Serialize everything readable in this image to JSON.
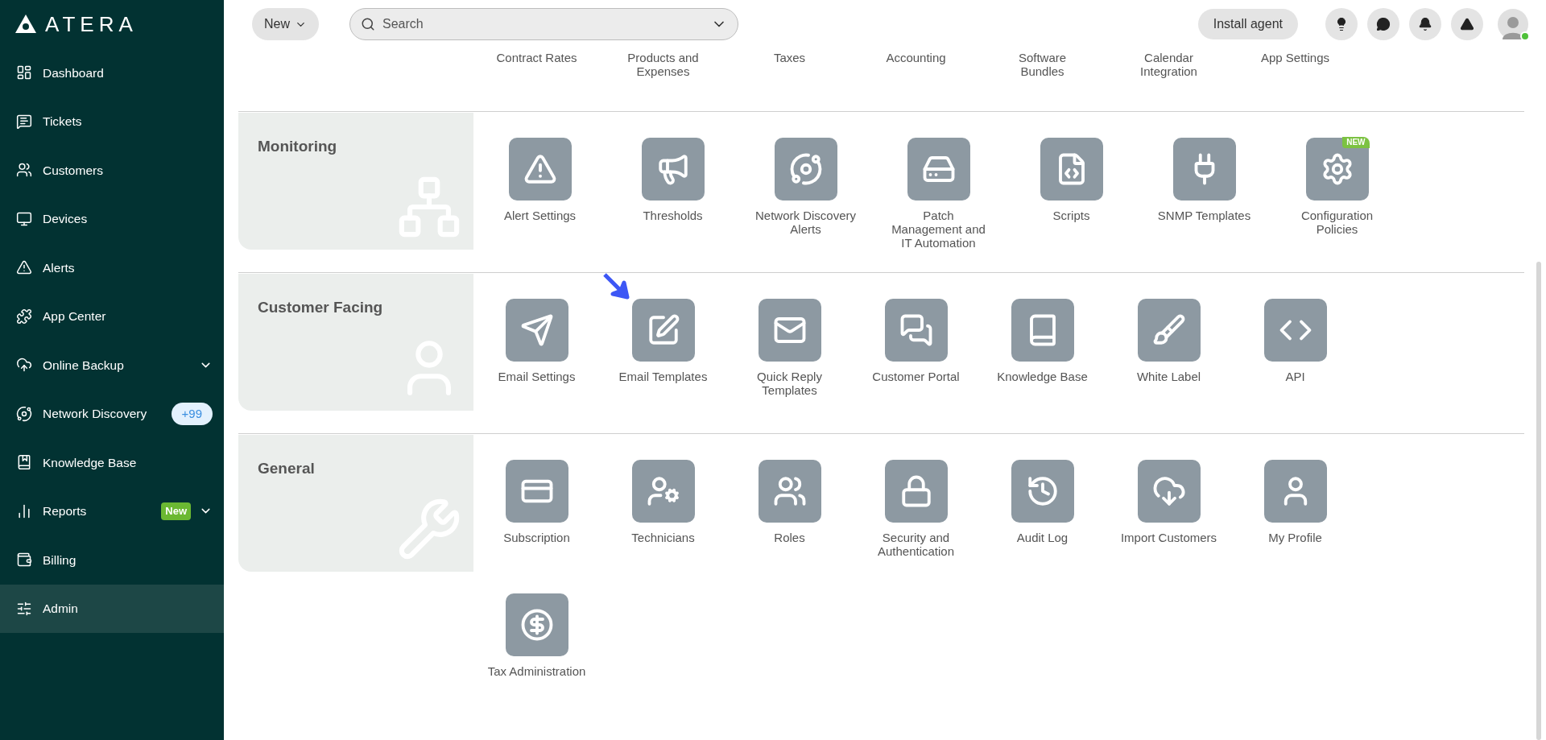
{
  "brand": {
    "name": "ATERA"
  },
  "sidebar": {
    "items": [
      {
        "label": "Dashboard",
        "selected": false,
        "expandable": false
      },
      {
        "label": "Tickets",
        "selected": false,
        "expandable": false
      },
      {
        "label": "Customers",
        "selected": false,
        "expandable": false
      },
      {
        "label": "Devices",
        "selected": false,
        "expandable": false
      },
      {
        "label": "Alerts",
        "selected": false,
        "expandable": false
      },
      {
        "label": "App Center",
        "selected": false,
        "expandable": false
      },
      {
        "label": "Online Backup",
        "selected": false,
        "expandable": true
      },
      {
        "label": "Network Discovery",
        "selected": false,
        "expandable": false,
        "badge": {
          "kind": "count",
          "text": "+99"
        }
      },
      {
        "label": "Knowledge Base",
        "selected": false,
        "expandable": false
      },
      {
        "label": "Reports",
        "selected": false,
        "expandable": true,
        "badge": {
          "kind": "new",
          "text": "New"
        }
      },
      {
        "label": "Billing",
        "selected": false,
        "expandable": false
      },
      {
        "label": "Admin",
        "selected": true,
        "expandable": false
      }
    ]
  },
  "topbar": {
    "new_button": "New",
    "search": {
      "placeholder": "Search"
    },
    "install_button": "Install agent",
    "user_online": true
  },
  "previous_section_items": [
    "Contract Rates",
    "Products and Expenses",
    "Taxes",
    "Accounting",
    "Software Bundles",
    "Calendar Integration",
    "App Settings"
  ],
  "sections": [
    {
      "title": "Monitoring",
      "items": [
        {
          "label": "Alert Settings"
        },
        {
          "label": "Thresholds"
        },
        {
          "label": "Network Discovery Alerts"
        },
        {
          "label": "Patch Management and IT Automation"
        },
        {
          "label": "Scripts"
        },
        {
          "label": "SNMP Templates"
        },
        {
          "label": "Configuration Policies",
          "badge": "NEW"
        }
      ]
    },
    {
      "title": "Customer Facing",
      "items": [
        {
          "label": "Email Settings"
        },
        {
          "label": "Email Templates",
          "pointed": true
        },
        {
          "label": "Quick Reply Templates"
        },
        {
          "label": "Customer Portal"
        },
        {
          "label": "Knowledge Base"
        },
        {
          "label": "White Label"
        },
        {
          "label": "API"
        }
      ]
    },
    {
      "title": "General",
      "items": [
        {
          "label": "Subscription"
        },
        {
          "label": "Technicians"
        },
        {
          "label": "Roles"
        },
        {
          "label": "Security and Authentication"
        },
        {
          "label": "Audit Log"
        },
        {
          "label": "Import Customers"
        },
        {
          "label": "My Profile"
        }
      ]
    }
  ],
  "extra_items": [
    {
      "label": "Tax Administration"
    }
  ]
}
